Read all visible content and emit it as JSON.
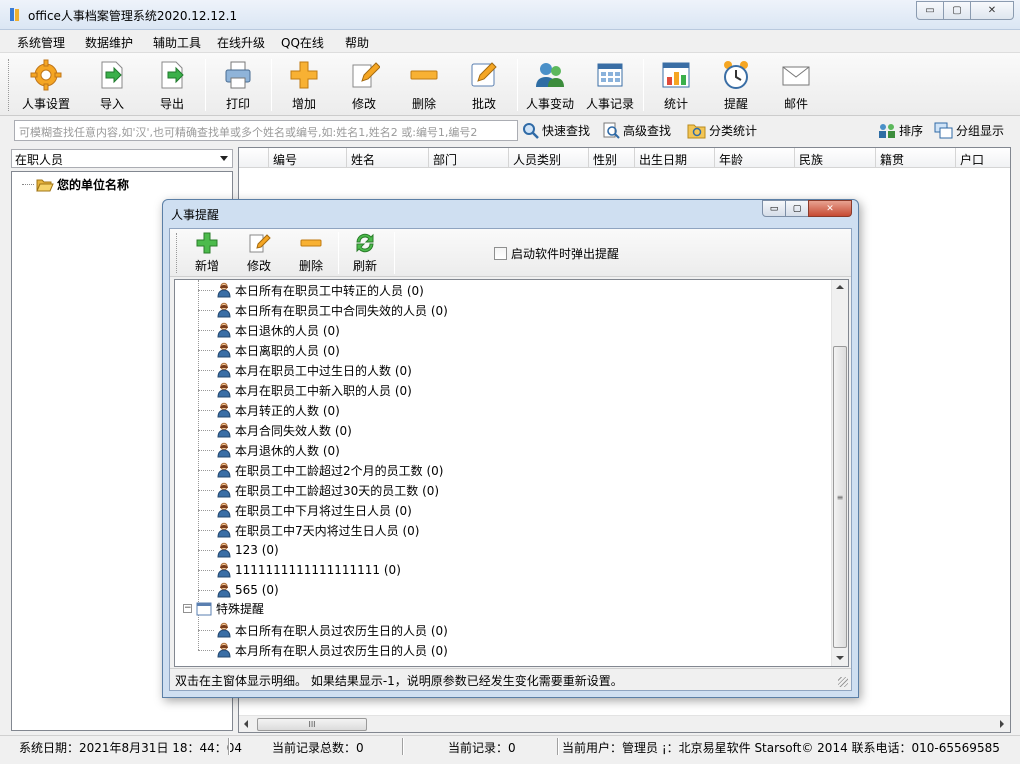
{
  "window": {
    "title": "office人事档案管理系统2020.12.12.1",
    "buttons": {
      "minimize": "▭",
      "maximize": "▢",
      "close": "✕"
    }
  },
  "menu": [
    "系统管理",
    "数据维护",
    "辅助工具",
    "在线升级",
    "QQ在线",
    "帮助"
  ],
  "toolbar": [
    {
      "label": "人事设置",
      "icon": "gear-icon"
    },
    {
      "label": "导入",
      "icon": "import-icon"
    },
    {
      "label": "导出",
      "icon": "export-icon"
    },
    {
      "label": "打印",
      "icon": "printer-icon"
    },
    {
      "label": "增加",
      "icon": "plus-icon"
    },
    {
      "label": "修改",
      "icon": "edit-icon"
    },
    {
      "label": "删除",
      "icon": "minus-icon"
    },
    {
      "label": "批改",
      "icon": "batch-edit-icon"
    },
    {
      "label": "人事变动",
      "icon": "users-icon"
    },
    {
      "label": "人事记录",
      "icon": "records-icon"
    },
    {
      "label": "统计",
      "icon": "stats-icon"
    },
    {
      "label": "提醒",
      "icon": "alarm-clock-icon"
    },
    {
      "label": "邮件",
      "icon": "mail-icon"
    }
  ],
  "search": {
    "placeholder": "可模糊查找任意内容,如'汉',也可精确查找单或多个姓名或编号,如:姓名1,姓名2 或:编号1,编号2",
    "quick_search": "快速查找",
    "advanced_search": "高级查找",
    "category_stats": "分类统计",
    "sort": "排序",
    "group_display": "分组显示"
  },
  "left_panel": {
    "selected_filter": "在职人员",
    "tree_root": "您的单位名称"
  },
  "grid": {
    "columns": [
      "编号",
      "姓名",
      "部门",
      "人员类别",
      "性别",
      "出生日期",
      "年龄",
      "民族",
      "籍贯",
      "户口"
    ],
    "scroll_thumb": "III"
  },
  "statusbar": {
    "system_date": "系统日期：2021年8月31日   18：44：04",
    "total_records": "当前记录总数：0",
    "current_record": "当前记录：0",
    "current_user": "当前用户：管理员 ¡：北京易星软件 Starsoft© 2014   联系电话：010-65569585"
  },
  "dialog": {
    "title": "人事提醒",
    "toolbar": [
      "新增",
      "修改",
      "删除",
      "刷新"
    ],
    "popup_on_start": "启动软件时弹出提醒",
    "popup_on_start_checked": false,
    "items": [
      "本日所有在职员工中转正的人员 (0)",
      "本日所有在职员工中合同失效的人员 (0)",
      "本日退休的人员 (0)",
      "本日离职的人员 (0)",
      "本月在职员工中过生日的人数 (0)",
      "本月在职员工中新入职的人员 (0)",
      "本月转正的人数 (0)",
      "本月合同失效人数 (0)",
      "本月退休的人数 (0)",
      "在职员工中工龄超过2个月的员工数 (0)",
      "在职员工中工龄超过30天的员工数 (0)",
      "在职员工中下月将过生日人员 (0)",
      "在职员工中7天内将过生日人员 (0)",
      "123 (0)",
      "1111111111111111111 (0)",
      "565 (0)"
    ],
    "group_special": "特殊提醒",
    "special_items": [
      "本日所有在职人员过农历生日的人员 (0)",
      "本月所有在职人员过农历生日的人员 (0)"
    ],
    "vscroll_grip": "≡",
    "status": "双击在主窗体显示明细。 如果结果显示-1，说明原参数已经发生变化需要重新设置。"
  }
}
